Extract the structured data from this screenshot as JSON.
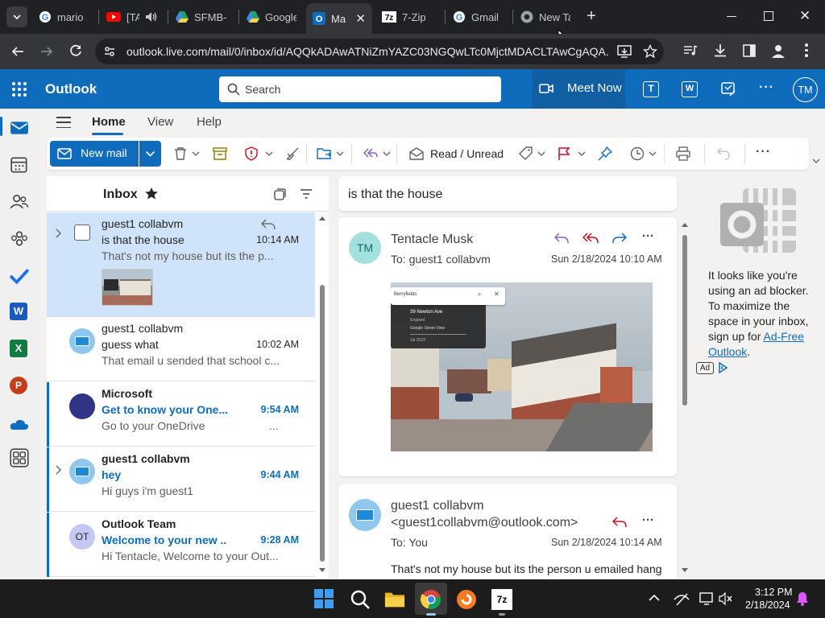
{
  "browser": {
    "tabs": [
      {
        "title": "mario",
        "icon": "google-icon"
      },
      {
        "title": "[TA",
        "icon": "youtube-icon"
      },
      {
        "title": "SFMB-",
        "icon": "google-drive-icon"
      },
      {
        "title": "Google",
        "icon": "google-drive-icon"
      },
      {
        "title": "Ma",
        "icon": "outlook-icon"
      },
      {
        "title": "7-Zip",
        "icon": "7zip-icon"
      },
      {
        "title": "Gmail",
        "icon": "google-icon"
      },
      {
        "title": "New Ta",
        "icon": "chrome-icon"
      }
    ],
    "url": "outlook.live.com/mail/0/inbox/id/AQQkADAwATNiZmYAZC03NGQwLTc0MjctMDACLTAwCgAQA..."
  },
  "outlook": {
    "app_name": "Outlook",
    "search_placeholder": "Search",
    "meet_now": "Meet Now",
    "user_initials": "TM",
    "nav_tabs": [
      "Home",
      "View",
      "Help"
    ],
    "ribbon": {
      "new_mail": "New mail",
      "read_unread": "Read / Unread"
    },
    "folder": "Inbox",
    "messages": [
      {
        "from": "guest1 collabvm",
        "subject": "is that the house",
        "time": "10:14 AM",
        "preview": "That's not my house but its the p..."
      },
      {
        "from": "guest1 collabvm",
        "subject": "guess what",
        "time": "10:02 AM",
        "preview": "That email u sended that school c..."
      },
      {
        "from": "Microsoft",
        "subject": "Get to know your One...",
        "time": "9:54 AM",
        "preview": "Go to your OneDrive",
        "preview_suffix": "..."
      },
      {
        "from": "guest1 collabvm",
        "subject": "hey",
        "time": "9:44 AM",
        "preview": "Hi guys i'm guest1"
      },
      {
        "from": "Outlook Team",
        "subject": "Welcome to your new ...",
        "time": "9:28 AM",
        "preview": "Hi Tentacle, Welcome to your Out...",
        "initials": "OT"
      }
    ],
    "reading": {
      "subject": "is that the house",
      "msg1": {
        "initials": "TM",
        "from": "Tentacle Musk",
        "to": "To:  guest1 collabvm",
        "date": "Sun 2/18/2024 10:10 AM",
        "image_text_1": "Berryfields",
        "image_text_2": "39 Newton Ave",
        "image_text_3": "England",
        "image_text_4": "Google Street View",
        "image_text_5": "Jul 2023"
      },
      "msg2": {
        "from": "guest1 collabvm",
        "email": "<guest1collabvm@outlook.com>",
        "to": "To:  You",
        "date": "Sun 2/18/2024 10:14 AM",
        "body": "That's not my house but its the person u emailed hang"
      }
    },
    "ad": {
      "text": "It looks like you're using an ad blocker. To maximize the space in your inbox, sign up for",
      "link": "Ad-Free Outlook",
      "link_suffix": ".",
      "badge": "Ad"
    }
  },
  "taskbar": {
    "time": "3:12 PM",
    "date": "2/18/2024"
  },
  "colors": {
    "outlook_blue": "#0f6cbd",
    "selected_row": "#cfe4fa",
    "chrome_dark": "#202124"
  }
}
